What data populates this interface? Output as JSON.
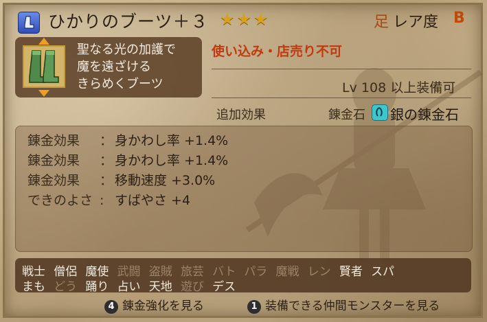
{
  "item": {
    "name": "ひかりのブーツ＋３",
    "icon": "boot-category-icon",
    "stars": "★★★",
    "slot_kanji": "足",
    "rarity_label": "レア度",
    "rarity_grade": "B",
    "description": [
      "聖なる光の加護で",
      "魔を遠ざける",
      "きらめくブーツ"
    ],
    "restriction": "使い込み・店売り不可",
    "level_prefix": "Lv",
    "level": "108",
    "level_suffix": "以上装備可"
  },
  "alchemy": {
    "bonus_label": "追加効果",
    "stone_label": "錬金石",
    "stone_icon": "silver-alchemy-stone-icon",
    "stone_name": "銀の錬金石"
  },
  "effects": [
    {
      "label": "錬金効果",
      "colon": "：",
      "value": "身かわし率 +1.4%"
    },
    {
      "label": "錬金効果",
      "colon": "：",
      "value": "身かわし率 +1.4%"
    },
    {
      "label": "錬金効果",
      "colon": "：",
      "value": "移動速度 +3.0%"
    },
    {
      "label": "できのよさ",
      "colon": ":",
      "value": "すばやさ +4"
    }
  ],
  "jobs": {
    "row1": [
      {
        "name": "戦士",
        "equippable": true
      },
      {
        "name": "僧侶",
        "equippable": true
      },
      {
        "name": "魔使",
        "equippable": true
      },
      {
        "name": "武闘",
        "equippable": false
      },
      {
        "name": "盗賊",
        "equippable": false
      },
      {
        "name": "旅芸",
        "equippable": false
      },
      {
        "name": "バト",
        "equippable": false
      },
      {
        "name": "パラ",
        "equippable": false
      },
      {
        "name": "魔戦",
        "equippable": false
      },
      {
        "name": "レン",
        "equippable": false
      },
      {
        "name": "賢者",
        "equippable": true
      },
      {
        "name": "スパ",
        "equippable": true
      }
    ],
    "row2": [
      {
        "name": "まも",
        "equippable": true
      },
      {
        "name": "どう",
        "equippable": false
      },
      {
        "name": "踊り",
        "equippable": true
      },
      {
        "name": "占い",
        "equippable": true
      },
      {
        "name": "天地",
        "equippable": true
      },
      {
        "name": "遊び",
        "equippable": false
      },
      {
        "name": "デス",
        "equippable": true
      }
    ]
  },
  "hints": [
    {
      "button": "4",
      "label": "錬金強化を見る"
    },
    {
      "button": "1",
      "label": "装備できる仲間モンスターを見る"
    }
  ],
  "colors": {
    "equippable": "#f2ebdd",
    "not_equippable": "#9a8466",
    "restriction": "#c03a10",
    "rarity_grade": "#c24a08"
  }
}
